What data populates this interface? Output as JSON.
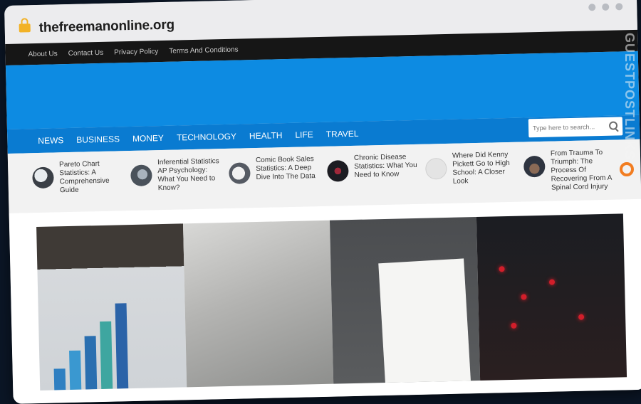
{
  "browser": {
    "domain": "thefreemanonline.org"
  },
  "top_menu": [
    "About Us",
    "Contact Us",
    "Privacy Policy",
    "Terms And Conditions"
  ],
  "main_nav": [
    "NEWS",
    "BUSINESS",
    "MONEY",
    "TECHNOLOGY",
    "HEALTH",
    "LIFE",
    "TRAVEL"
  ],
  "search": {
    "placeholder": "Type here to search..."
  },
  "news_strip": [
    "Pareto Chart Statistics: A Comprehensive Guide",
    "Inferential Statistics AP Psychology: What You Need to Know?",
    "Comic Book Sales Statistics: A Deep Dive Into The Data",
    "Chronic Disease Statistics: What You Need to Know",
    "Where Did Kenny Pickett Go to High School: A Closer Look",
    "From Trauma To Triumph: The Process Of Recovering From A Spinal Cord Injury"
  ],
  "watermark": {
    "text": "GUESTPOSTLINKS"
  },
  "colors": {
    "brand_blue": "#0d8be2",
    "nav_blue": "#0a7bd1",
    "top_bar": "#161616",
    "accent_orange": "#f27d21"
  },
  "icons": {
    "lock": "lock-icon",
    "search": "search-icon"
  }
}
